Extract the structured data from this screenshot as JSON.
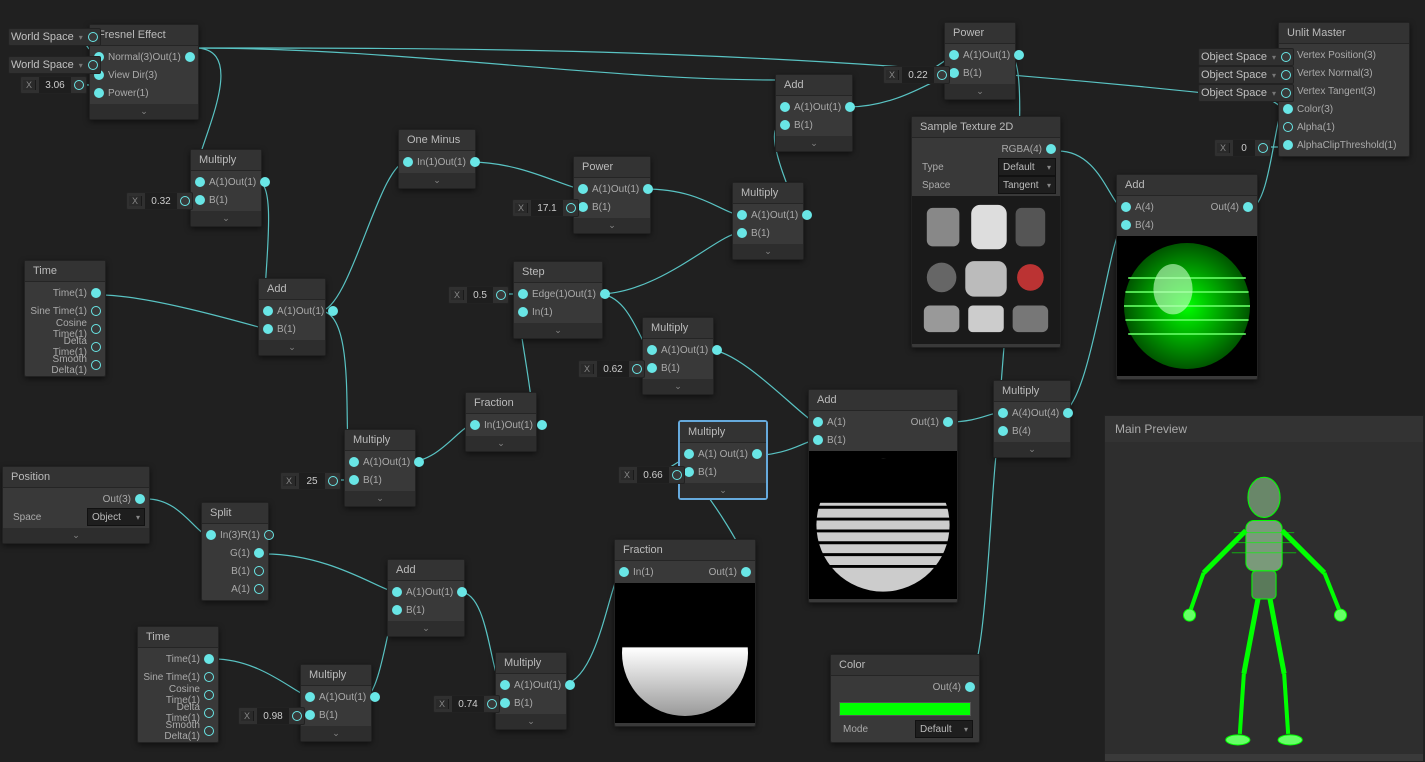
{
  "labels": {
    "multiply": "Multiply",
    "add": "Add",
    "time": "Time",
    "one_minus": "One Minus",
    "power": "Power",
    "fraction": "Fraction",
    "step": "Step",
    "split": "Split",
    "position": "Position",
    "color": "Color",
    "sample_tex": "Sample Texture 2D",
    "unlit": "Unlit Master",
    "main_preview": "Main Preview",
    "type": "Type",
    "space": "Space",
    "mode": "Mode"
  },
  "ports": {
    "a1": "A(1)",
    "b1": "B(1)",
    "out1": "Out(1)",
    "in1": "In(1)",
    "edge": "Edge(1)",
    "a4": "A(4)",
    "b4": "B(4)",
    "out4": "Out(4)",
    "rgba": "RGBA(4)",
    "in3": "In(3)",
    "out3": "Out(3)",
    "r": "R(1)",
    "g": "G(1)",
    "b": "B(1)",
    "a": "A(1)",
    "time": "Time(1)",
    "sine": "Sine Time(1)",
    "cosine": "Cosine Time(1)",
    "delta": "Delta Time(1)",
    "smooth": "Smooth Delta(1)",
    "vpos": "Vertex Position(3)",
    "vnorm": "Vertex Normal(3)",
    "vtan": "Vertex Tangent(3)",
    "color3": "Color(3)",
    "alpha": "Alpha(1)",
    "aclip": "AlphaClipThreshold(1)"
  },
  "pills": {
    "world_space": "World Space",
    "object_space": "Object Space",
    "fresnel_power": "3.06",
    "mult1_b": "0.32",
    "power_b": "17.1",
    "power2_a": "0.22",
    "mult3_b": "25",
    "step_edge": "0.5",
    "mult5_b": "0.62",
    "mult8_b": "0.66",
    "mult6_b": "0.98",
    "mult7_b": "0.74",
    "aclip": "0"
  },
  "nodes": {
    "fresnel": {
      "title": "Fresnel Effect",
      "ports": {
        "normal": "Normal(3)",
        "viewdir": "View Dir(3)",
        "power": "Power(1)",
        "out": "Out(1)"
      }
    },
    "sample": {
      "type": "Default",
      "space": "Tangent"
    },
    "position": {
      "space": "Object"
    },
    "color": {
      "mode": "Default",
      "value": "#00ff00"
    }
  },
  "colors": {
    "wire": "#59c3c3",
    "accent": "#00ff00",
    "bg": "#202020",
    "node": "#393939"
  }
}
